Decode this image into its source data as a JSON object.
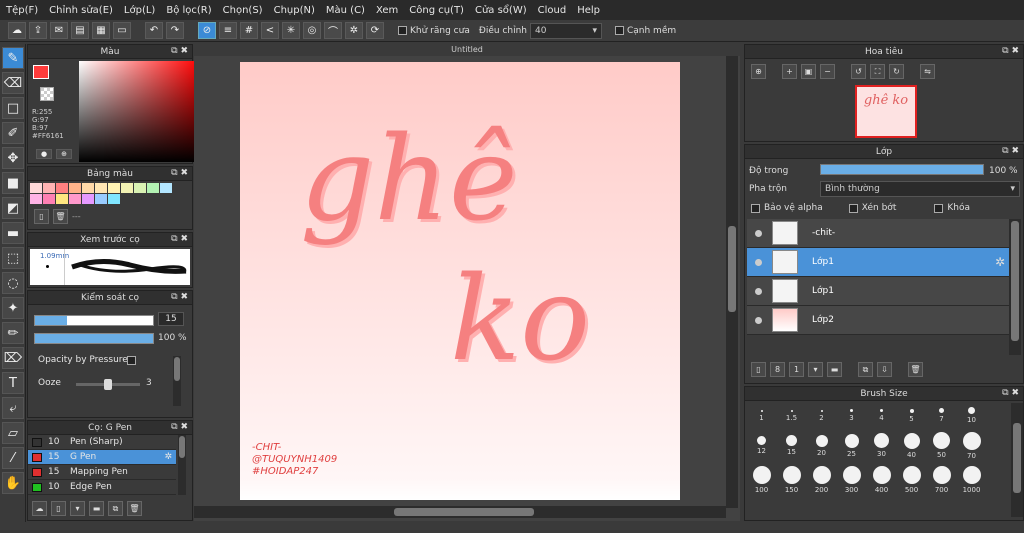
{
  "menu": [
    "Tệp(F)",
    "Chỉnh sửa(E)",
    "Lớp(L)",
    "Bộ lọc(R)",
    "Chọn(S)",
    "Chụp(N)",
    "Màu (C)",
    "Xem",
    "Công cụ(T)",
    "Cửa sổ(W)",
    "Cloud",
    "Help"
  ],
  "toolbar": {
    "antialias_label": "Khử răng cưa",
    "adjust_label": "Điều chỉnh",
    "adjust_value": "40",
    "snap_label": "Cạnh mềm"
  },
  "color_panel": {
    "title": "Màu",
    "r": "R:255",
    "g": "G:97",
    "b": "B:97",
    "hex": "#FF6161",
    "main_color": "#ff3b3b"
  },
  "palette": {
    "title": "Bảng màu",
    "colors": [
      "#ffd9d9",
      "#ffb3b3",
      "#ff8080",
      "#ffb38a",
      "#ffd9a8",
      "#ffe6b3",
      "#fff2b3",
      "#f2f2b3",
      "#d9f2b3",
      "#b3f2b3",
      "#b3e6ff",
      "#ffb3e6",
      "#ff80b3",
      "#ffe680",
      "#ff99cc",
      "#e699ff",
      "#99ccff",
      "#80e6ff"
    ],
    "placeholder": "---"
  },
  "preview": {
    "title": "Xem trước cọ",
    "size": "1.09mm"
  },
  "control": {
    "title": "Kiểm soát cọ",
    "size": "15",
    "opacity": "100 %",
    "opacity_pressure": "Opacity by Pressure",
    "ooze_label": "Ooze",
    "ooze_value": "3",
    "size_fraction": 0.27,
    "opacity_fraction": 1.0,
    "ooze_fraction": 0.5
  },
  "brush": {
    "title": "Cọ: G Pen",
    "items": [
      {
        "size": "10",
        "name": "Pen (Sharp)",
        "color": "#333333"
      },
      {
        "size": "15",
        "name": "G Pen",
        "color": "#e03030"
      },
      {
        "size": "15",
        "name": "Mapping Pen",
        "color": "#e03030"
      },
      {
        "size": "10",
        "name": "Edge Pen",
        "color": "#20c020"
      }
    ]
  },
  "canvas": {
    "tab": "Untitled",
    "art_line1": "ghê",
    "art_line2": "ko",
    "credit1": "-CHIT-",
    "credit2": "@TUQUYNH1409",
    "credit3": "#HOIDAP247"
  },
  "navigator": {
    "title": "Hoa tiêu",
    "thumb_text": "ghê ko"
  },
  "layers": {
    "title": "Lớp",
    "opacity_label": "Độ trong",
    "opacity_value": "100 %",
    "opacity_fraction": 1.0,
    "blend_label": "Pha trộn",
    "blend_value": "Bình thường",
    "protect_alpha": "Bảo vệ alpha",
    "clipping": "Xén bớt",
    "lock": "Khóa",
    "items": [
      {
        "name": "-chit-"
      },
      {
        "name": "Lớp1"
      },
      {
        "name": "Lớp1"
      },
      {
        "name": "Lớp2"
      }
    ]
  },
  "brush_size": {
    "title": "Brush Size",
    "sizes": [
      "1",
      "1.5",
      "2",
      "3",
      "4",
      "5",
      "7",
      "10",
      "12",
      "15",
      "20",
      "25",
      "30",
      "40",
      "50",
      "70",
      "100",
      "150",
      "200",
      "300",
      "400",
      "500",
      "700",
      "1000"
    ]
  }
}
